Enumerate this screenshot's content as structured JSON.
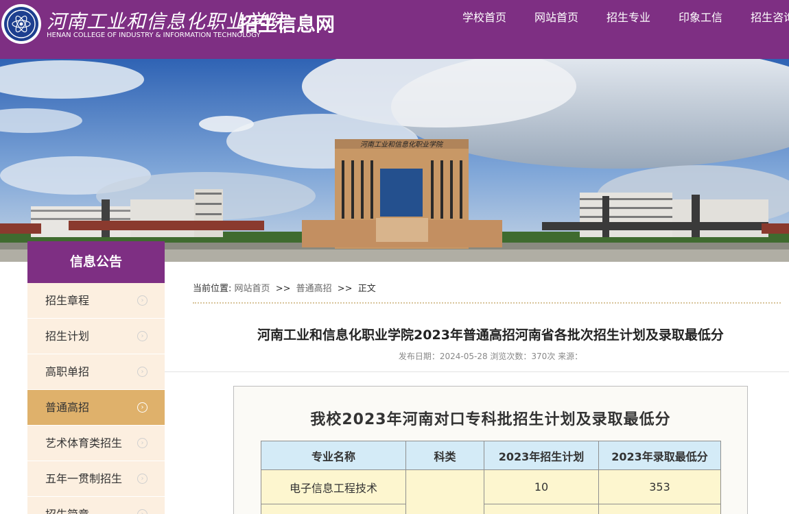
{
  "header": {
    "logo_cn": "河南工业和信息化职业学院",
    "logo_en": "HENAN COLLEGE OF INDUSTRY & INFORMATION TECHNOLOGY",
    "site_title": "招生信息网",
    "nav": [
      "学校首页",
      "网站首页",
      "招生专业",
      "印象工信",
      "招生咨询"
    ]
  },
  "banner": {
    "building_sign": "河南工业和信息化职业学院"
  },
  "sidebar": {
    "title": "信息公告",
    "items": [
      {
        "label": "招生章程"
      },
      {
        "label": "招生计划"
      },
      {
        "label": "高职单招"
      },
      {
        "label": "普通高招",
        "active": true
      },
      {
        "label": "艺术体育类招生"
      },
      {
        "label": "五年一贯制招生"
      },
      {
        "label": "招生简章"
      }
    ]
  },
  "breadcrumb": {
    "prefix": "当前位置:",
    "home": "网站首页",
    "sep": ">>",
    "section": "普通高招",
    "current": "正文"
  },
  "article": {
    "title": "河南工业和信息化职业学院2023年普通高招河南省各批次招生计划及录取最低分",
    "meta": "发布日期：2024-05-28  浏览次数：370次 来源："
  },
  "table_image": {
    "title": "我校2023年河南对口专科批招生计划及录取最低分",
    "headers": [
      "专业名称",
      "科类",
      "2023年招生计划",
      "2023年录取最低分"
    ],
    "rows": [
      [
        "电子信息工程技术",
        "",
        "10",
        "353"
      ],
      [
        "",
        "",
        "",
        ""
      ]
    ]
  },
  "colors": {
    "brand_purple": "#7e2f83",
    "sidebar_bg": "#fcefe0",
    "sidebar_active": "#dfb16b",
    "table_header_bg": "#d4ebf7",
    "table_cell_bg": "#fdf6cf"
  },
  "icons": {
    "sidebar_arrow": "circle-chevron-right-icon",
    "logo": "college-emblem-icon"
  }
}
